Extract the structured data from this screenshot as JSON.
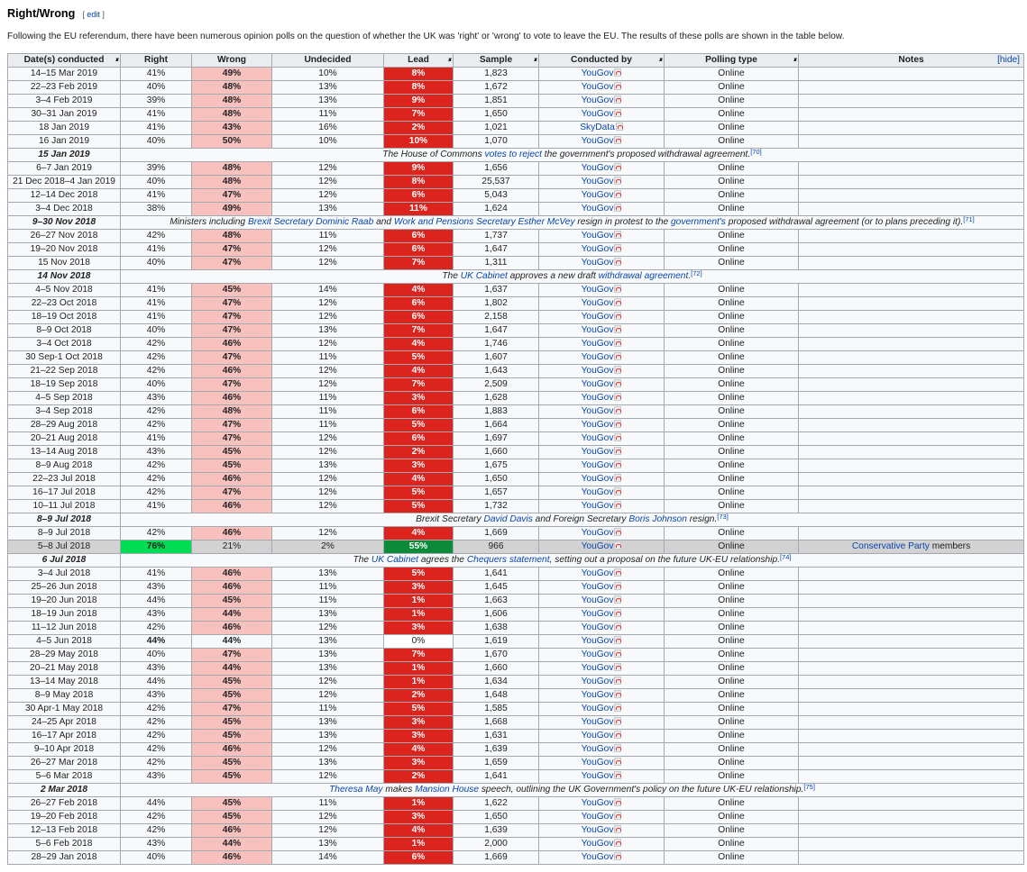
{
  "section": {
    "title": "Right/Wrong",
    "edit_open": "[ ",
    "edit_label": "edit",
    "edit_close": " ]"
  },
  "intro": "Following the EU referendum, there have been numerous opinion polls on the question of whether the UK was 'right' or 'wrong' to vote to leave the EU. The results of these polls are shown in the table below.",
  "columns": {
    "date": "Date(s) conducted",
    "right": "Right",
    "wrong": "Wrong",
    "undecided": "Undecided",
    "lead": "Lead",
    "sample": "Sample",
    "conducted_by": "Conducted by",
    "polling_type": "Polling type",
    "notes": "Notes",
    "hide_label": "[hide]"
  },
  "colors": {
    "right_header": "#008b00",
    "wrong_header": "#dc241f",
    "undecided_header": "#c0c0c0",
    "wrong_highlight": "#f8c1be",
    "right_highlight": "#00dd55",
    "lead_red": "#dc241f",
    "lead_green": "#0b8a3a",
    "link": "#0645ad"
  },
  "icons": {
    "pdf": "pdf-icon"
  },
  "rows": [
    {
      "kind": "poll",
      "date": "14–15 Mar 2019",
      "right": "41%",
      "wrong": "49%",
      "und": "10%",
      "lead": "8%",
      "sample": "1,823",
      "by": "YouGov",
      "type": "Online"
    },
    {
      "kind": "poll",
      "date": "22–23 Feb 2019",
      "right": "40%",
      "wrong": "48%",
      "und": "13%",
      "lead": "8%",
      "sample": "1,672",
      "by": "YouGov",
      "type": "Online"
    },
    {
      "kind": "poll",
      "date": "3–4 Feb 2019",
      "right": "39%",
      "wrong": "48%",
      "und": "13%",
      "lead": "9%",
      "sample": "1,851",
      "by": "YouGov",
      "type": "Online"
    },
    {
      "kind": "poll",
      "date": "30–31 Jan 2019",
      "right": "41%",
      "wrong": "48%",
      "und": "11%",
      "lead": "7%",
      "sample": "1,650",
      "by": "YouGov",
      "type": "Online"
    },
    {
      "kind": "poll",
      "date": "18 Jan 2019",
      "right": "41%",
      "wrong": "43%",
      "und": "16%",
      "lead": "2%",
      "sample": "1,021",
      "by": "SkyData",
      "type": "Online"
    },
    {
      "kind": "poll",
      "date": "16 Jan 2019",
      "right": "40%",
      "wrong": "50%",
      "und": "10%",
      "lead": "10%",
      "sample": "1,070",
      "by": "YouGov",
      "type": "Online"
    },
    {
      "kind": "event",
      "date": "15 Jan 2019",
      "parts": [
        {
          "t": "The House of Commons "
        },
        {
          "t": "votes to reject",
          "link": true
        },
        {
          "t": " the government's proposed withdrawal agreement."
        }
      ],
      "ref": "[70]"
    },
    {
      "kind": "poll",
      "date": "6–7 Jan 2019",
      "right": "39%",
      "wrong": "48%",
      "und": "12%",
      "lead": "9%",
      "sample": "1,656",
      "by": "YouGov",
      "type": "Online"
    },
    {
      "kind": "poll",
      "date": "21 Dec 2018–4 Jan 2019",
      "right": "40%",
      "wrong": "48%",
      "und": "12%",
      "lead": "8%",
      "sample": "25,537",
      "by": "YouGov",
      "type": "Online"
    },
    {
      "kind": "poll",
      "date": "12–14 Dec 2018",
      "right": "41%",
      "wrong": "47%",
      "und": "12%",
      "lead": "6%",
      "sample": "5,043",
      "by": "YouGov",
      "type": "Online"
    },
    {
      "kind": "poll",
      "date": "3–4 Dec 2018",
      "right": "38%",
      "wrong": "49%",
      "und": "13%",
      "lead": "11%",
      "sample": "1,624",
      "by": "YouGov",
      "type": "Online"
    },
    {
      "kind": "event",
      "date": "9–30 Nov 2018",
      "parts": [
        {
          "t": "Ministers including "
        },
        {
          "t": "Brexit Secretary",
          "link": true
        },
        {
          "t": " "
        },
        {
          "t": "Dominic Raab",
          "link": true
        },
        {
          "t": " and "
        },
        {
          "t": "Work and Pensions Secretary",
          "link": true
        },
        {
          "t": " "
        },
        {
          "t": "Esther McVey",
          "link": true
        },
        {
          "t": " resign in protest to the "
        },
        {
          "t": "government's",
          "link": true
        },
        {
          "t": " proposed withdrawal agreement (or to plans preceding it)."
        }
      ],
      "ref": "[71]"
    },
    {
      "kind": "poll",
      "date": "26–27 Nov 2018",
      "right": "42%",
      "wrong": "48%",
      "und": "11%",
      "lead": "6%",
      "sample": "1,737",
      "by": "YouGov",
      "type": "Online"
    },
    {
      "kind": "poll",
      "date": "19–20 Nov 2018",
      "right": "41%",
      "wrong": "47%",
      "und": "12%",
      "lead": "6%",
      "sample": "1,647",
      "by": "YouGov",
      "type": "Online"
    },
    {
      "kind": "poll",
      "date": "15 Nov 2018",
      "right": "40%",
      "wrong": "47%",
      "und": "12%",
      "lead": "7%",
      "sample": "1,311",
      "by": "YouGov",
      "type": "Online"
    },
    {
      "kind": "event",
      "date": "14 Nov 2018",
      "parts": [
        {
          "t": "The "
        },
        {
          "t": "UK Cabinet",
          "link": true
        },
        {
          "t": " approves a new draft "
        },
        {
          "t": "withdrawal agreement",
          "link": true
        },
        {
          "t": "."
        }
      ],
      "ref": "[72]"
    },
    {
      "kind": "poll",
      "date": "4–5 Nov 2018",
      "right": "41%",
      "wrong": "45%",
      "und": "14%",
      "lead": "4%",
      "sample": "1,637",
      "by": "YouGov",
      "type": "Online"
    },
    {
      "kind": "poll",
      "date": "22–23 Oct 2018",
      "right": "41%",
      "wrong": "47%",
      "und": "12%",
      "lead": "6%",
      "sample": "1,802",
      "by": "YouGov",
      "type": "Online"
    },
    {
      "kind": "poll",
      "date": "18–19 Oct 2018",
      "right": "41%",
      "wrong": "47%",
      "und": "12%",
      "lead": "6%",
      "sample": "2,158",
      "by": "YouGov",
      "type": "Online"
    },
    {
      "kind": "poll",
      "date": "8–9 Oct 2018",
      "right": "40%",
      "wrong": "47%",
      "und": "13%",
      "lead": "7%",
      "sample": "1,647",
      "by": "YouGov",
      "type": "Online"
    },
    {
      "kind": "poll",
      "date": "3–4 Oct 2018",
      "right": "42%",
      "wrong": "46%",
      "und": "12%",
      "lead": "4%",
      "sample": "1,746",
      "by": "YouGov",
      "type": "Online"
    },
    {
      "kind": "poll",
      "date": "30 Sep-1 Oct 2018",
      "right": "42%",
      "wrong": "47%",
      "und": "11%",
      "lead": "5%",
      "sample": "1,607",
      "by": "YouGov",
      "type": "Online"
    },
    {
      "kind": "poll",
      "date": "21–22 Sep 2018",
      "right": "42%",
      "wrong": "46%",
      "und": "12%",
      "lead": "4%",
      "sample": "1,643",
      "by": "YouGov",
      "type": "Online"
    },
    {
      "kind": "poll",
      "date": "18–19 Sep 2018",
      "right": "40%",
      "wrong": "47%",
      "und": "12%",
      "lead": "7%",
      "sample": "2,509",
      "by": "YouGov",
      "type": "Online"
    },
    {
      "kind": "poll",
      "date": "4–5 Sep 2018",
      "right": "43%",
      "wrong": "46%",
      "und": "11%",
      "lead": "3%",
      "sample": "1,628",
      "by": "YouGov",
      "type": "Online"
    },
    {
      "kind": "poll",
      "date": "3–4 Sep 2018",
      "right": "42%",
      "wrong": "48%",
      "und": "11%",
      "lead": "6%",
      "sample": "1,883",
      "by": "YouGov",
      "type": "Online"
    },
    {
      "kind": "poll",
      "date": "28–29 Aug 2018",
      "right": "42%",
      "wrong": "47%",
      "und": "11%",
      "lead": "5%",
      "sample": "1,664",
      "by": "YouGov",
      "type": "Online"
    },
    {
      "kind": "poll",
      "date": "20–21 Aug 2018",
      "right": "41%",
      "wrong": "47%",
      "und": "12%",
      "lead": "6%",
      "sample": "1,697",
      "by": "YouGov",
      "type": "Online"
    },
    {
      "kind": "poll",
      "date": "13–14 Aug 2018",
      "right": "43%",
      "wrong": "45%",
      "und": "12%",
      "lead": "2%",
      "sample": "1,660",
      "by": "YouGov",
      "type": "Online"
    },
    {
      "kind": "poll",
      "date": "8–9 Aug 2018",
      "right": "42%",
      "wrong": "45%",
      "und": "13%",
      "lead": "3%",
      "sample": "1,675",
      "by": "YouGov",
      "type": "Online"
    },
    {
      "kind": "poll",
      "date": "22–23 Jul 2018",
      "right": "42%",
      "wrong": "46%",
      "und": "12%",
      "lead": "4%",
      "sample": "1,650",
      "by": "YouGov",
      "type": "Online"
    },
    {
      "kind": "poll",
      "date": "16–17 Jul 2018",
      "right": "42%",
      "wrong": "47%",
      "und": "12%",
      "lead": "5%",
      "sample": "1,657",
      "by": "YouGov",
      "type": "Online"
    },
    {
      "kind": "poll",
      "date": "10–11 Jul 2018",
      "right": "41%",
      "wrong": "46%",
      "und": "12%",
      "lead": "5%",
      "sample": "1,732",
      "by": "YouGov",
      "type": "Online"
    },
    {
      "kind": "event",
      "date": "8–9 Jul 2018",
      "parts": [
        {
          "t": "Brexit Secretary "
        },
        {
          "t": "David Davis",
          "link": true
        },
        {
          "t": " and Foreign Secretary "
        },
        {
          "t": "Boris Johnson",
          "link": true
        },
        {
          "t": " resign."
        }
      ],
      "ref": "[73]"
    },
    {
      "kind": "poll",
      "date": "8–9 Jul 2018",
      "right": "42%",
      "wrong": "46%",
      "und": "12%",
      "lead": "4%",
      "sample": "1,669",
      "by": "YouGov",
      "type": "Online"
    },
    {
      "kind": "poll",
      "variant": "grey",
      "date": "5–8 Jul 2018",
      "right": "76%",
      "wrong": "21%",
      "und": "2%",
      "lead": "55%",
      "sample": "966",
      "by": "YouGov",
      "type": "Online",
      "notes_link": "Conservative Party",
      "notes_text": " members"
    },
    {
      "kind": "event",
      "date": "6 Jul 2018",
      "parts": [
        {
          "t": "The "
        },
        {
          "t": "UK Cabinet",
          "link": true
        },
        {
          "t": " agrees the "
        },
        {
          "t": "Chequers statement",
          "link": true
        },
        {
          "t": ", setting out a proposal on the future UK-EU relationship."
        }
      ],
      "ref": "[74]"
    },
    {
      "kind": "poll",
      "date": "3–4 Jul 2018",
      "right": "41%",
      "wrong": "46%",
      "und": "13%",
      "lead": "5%",
      "sample": "1,641",
      "by": "YouGov",
      "type": "Online"
    },
    {
      "kind": "poll",
      "date": "25–26 Jun 2018",
      "right": "43%",
      "wrong": "46%",
      "und": "11%",
      "lead": "3%",
      "sample": "1,645",
      "by": "YouGov",
      "type": "Online"
    },
    {
      "kind": "poll",
      "date": "19–20 Jun 2018",
      "right": "44%",
      "wrong": "45%",
      "und": "11%",
      "lead": "1%",
      "sample": "1,663",
      "by": "YouGov",
      "type": "Online"
    },
    {
      "kind": "poll",
      "date": "18–19 Jun 2018",
      "right": "43%",
      "wrong": "44%",
      "und": "13%",
      "lead": "1%",
      "sample": "1,606",
      "by": "YouGov",
      "type": "Online"
    },
    {
      "kind": "poll",
      "date": "11–12 Jun 2018",
      "right": "42%",
      "wrong": "46%",
      "und": "12%",
      "lead": "3%",
      "sample": "1,638",
      "by": "YouGov",
      "type": "Online"
    },
    {
      "kind": "poll",
      "variant": "tie",
      "date": "4–5 Jun 2018",
      "right": "44%",
      "wrong": "44%",
      "und": "13%",
      "lead": "0%",
      "sample": "1,619",
      "by": "YouGov",
      "type": "Online"
    },
    {
      "kind": "poll",
      "date": "28–29 May 2018",
      "right": "40%",
      "wrong": "47%",
      "und": "13%",
      "lead": "7%",
      "sample": "1,670",
      "by": "YouGov",
      "type": "Online"
    },
    {
      "kind": "poll",
      "date": "20–21 May 2018",
      "right": "43%",
      "wrong": "44%",
      "und": "13%",
      "lead": "1%",
      "sample": "1,660",
      "by": "YouGov",
      "type": "Online"
    },
    {
      "kind": "poll",
      "date": "13–14 May 2018",
      "right": "44%",
      "wrong": "45%",
      "und": "12%",
      "lead": "1%",
      "sample": "1,634",
      "by": "YouGov",
      "type": "Online"
    },
    {
      "kind": "poll",
      "date": "8–9 May 2018",
      "right": "43%",
      "wrong": "45%",
      "und": "12%",
      "lead": "2%",
      "sample": "1,648",
      "by": "YouGov",
      "type": "Online"
    },
    {
      "kind": "poll",
      "date": "30 Apr-1 May 2018",
      "right": "42%",
      "wrong": "47%",
      "und": "11%",
      "lead": "5%",
      "sample": "1,585",
      "by": "YouGov",
      "type": "Online"
    },
    {
      "kind": "poll",
      "date": "24–25 Apr 2018",
      "right": "42%",
      "wrong": "45%",
      "und": "13%",
      "lead": "3%",
      "sample": "1,668",
      "by": "YouGov",
      "type": "Online"
    },
    {
      "kind": "poll",
      "date": "16–17 Apr 2018",
      "right": "42%",
      "wrong": "45%",
      "und": "13%",
      "lead": "3%",
      "sample": "1,631",
      "by": "YouGov",
      "type": "Online"
    },
    {
      "kind": "poll",
      "date": "9–10 Apr 2018",
      "right": "42%",
      "wrong": "46%",
      "und": "12%",
      "lead": "4%",
      "sample": "1,639",
      "by": "YouGov",
      "type": "Online"
    },
    {
      "kind": "poll",
      "date": "26–27 Mar 2018",
      "right": "42%",
      "wrong": "45%",
      "und": "13%",
      "lead": "3%",
      "sample": "1,659",
      "by": "YouGov",
      "type": "Online"
    },
    {
      "kind": "poll",
      "date": "5–6 Mar 2018",
      "right": "43%",
      "wrong": "45%",
      "und": "12%",
      "lead": "2%",
      "sample": "1,641",
      "by": "YouGov",
      "type": "Online"
    },
    {
      "kind": "event",
      "date": "2 Mar 2018",
      "parts": [
        {
          "t": "Theresa May",
          "link": true
        },
        {
          "t": " makes "
        },
        {
          "t": "Mansion House",
          "link": true
        },
        {
          "t": " speech, outlining the UK Government's policy on the future UK-EU relationship."
        }
      ],
      "ref": "[75]"
    },
    {
      "kind": "poll",
      "date": "26–27 Feb 2018",
      "right": "44%",
      "wrong": "45%",
      "und": "11%",
      "lead": "1%",
      "sample": "1,622",
      "by": "YouGov",
      "type": "Online"
    },
    {
      "kind": "poll",
      "date": "19–20 Feb 2018",
      "right": "42%",
      "wrong": "45%",
      "und": "12%",
      "lead": "3%",
      "sample": "1,650",
      "by": "YouGov",
      "type": "Online"
    },
    {
      "kind": "poll",
      "date": "12–13 Feb 2018",
      "right": "42%",
      "wrong": "46%",
      "und": "12%",
      "lead": "4%",
      "sample": "1,639",
      "by": "YouGov",
      "type": "Online"
    },
    {
      "kind": "poll",
      "date": "5–6 Feb 2018",
      "right": "43%",
      "wrong": "44%",
      "und": "13%",
      "lead": "1%",
      "sample": "2,000",
      "by": "YouGov",
      "type": "Online"
    },
    {
      "kind": "poll",
      "date": "28–29 Jan 2018",
      "right": "40%",
      "wrong": "46%",
      "und": "14%",
      "lead": "6%",
      "sample": "1,669",
      "by": "YouGov",
      "type": "Online"
    }
  ]
}
